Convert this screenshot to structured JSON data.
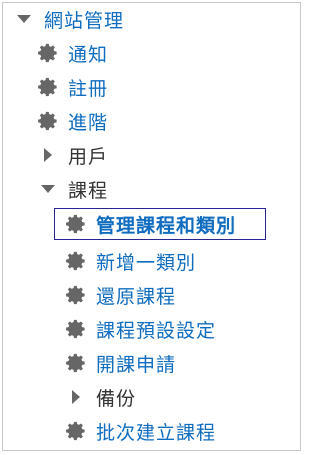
{
  "tree": {
    "root": {
      "label": "網站管理",
      "icon": "caret-down-icon"
    },
    "items": [
      {
        "label": "通知",
        "icon": "gear-icon"
      },
      {
        "label": "註冊",
        "icon": "gear-icon"
      },
      {
        "label": "進階",
        "icon": "gear-icon"
      },
      {
        "label": "用戶",
        "icon": "caret-right-icon"
      },
      {
        "label": "課程",
        "icon": "caret-down-icon"
      }
    ],
    "course_items": [
      {
        "label": "管理課程和類別",
        "icon": "gear-icon",
        "active": true
      },
      {
        "label": "新增一類別",
        "icon": "gear-icon"
      },
      {
        "label": "還原課程",
        "icon": "gear-icon"
      },
      {
        "label": "課程預設設定",
        "icon": "gear-icon"
      },
      {
        "label": "開課申請",
        "icon": "gear-icon"
      },
      {
        "label": "備份",
        "icon": "caret-right-icon"
      },
      {
        "label": "批次建立課程",
        "icon": "gear-icon"
      }
    ]
  },
  "colors": {
    "link": "#0f6cbf",
    "text": "#333333",
    "icon": "#666666",
    "active_border": "#27278f"
  }
}
